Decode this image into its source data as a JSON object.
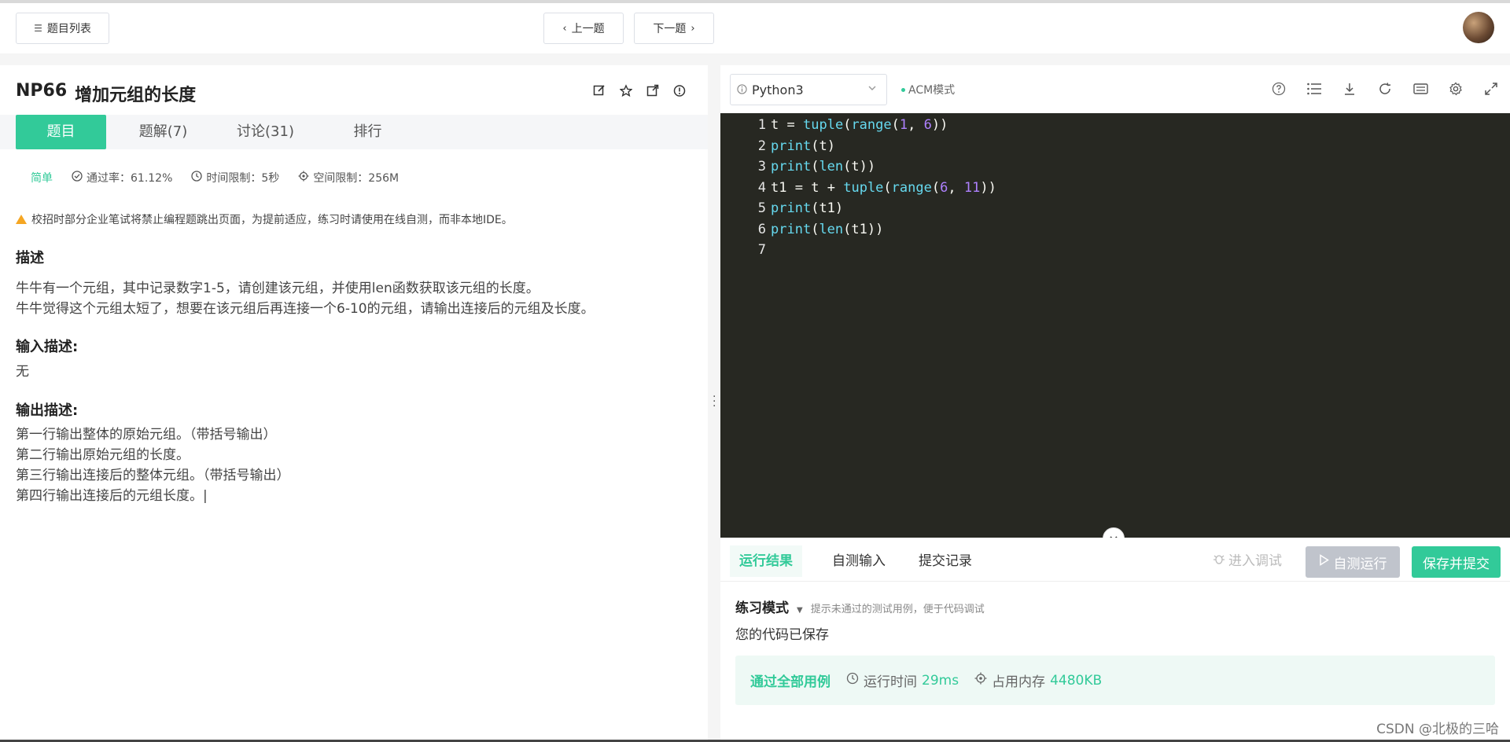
{
  "topbar": {
    "list_label": "题目列表",
    "prev_label": "上一题",
    "next_label": "下一题"
  },
  "problem": {
    "id": "NP66",
    "title": "增加元组的长度",
    "tabs": [
      "题目",
      "题解(7)",
      "讨论(31)",
      "排行"
    ],
    "difficulty": "简单",
    "pass_rate": "通过率：61.12%",
    "time_limit": "时间限制：5秒",
    "space_limit": "空间限制：256M",
    "notice": "校招时部分企业笔试将禁止编程题跳出页面，为提前适应，练习时请使用在线自测，而非本地IDE。",
    "desc_heading": "描述",
    "desc_lines": [
      "牛牛有一个元组，其中记录数字1-5，请创建该元组，并使用len函数获取该元组的长度。",
      "牛牛觉得这个元组太短了，想要在该元组后再连接一个6-10的元组，请输出连接后的元组及长度。"
    ],
    "input_heading": "输入描述:",
    "input_text": "无",
    "output_heading": "输出描述:",
    "output_lines": [
      "第一行输出整体的原始元组。（带括号输出）",
      "第二行输出原始元组的长度。",
      "第三行输出连接后的整体元组。（带括号输出）",
      "第四行输出连接后的元组长度。|"
    ]
  },
  "editor": {
    "language": "Python3",
    "mode": "ACM模式",
    "line_numbers": [
      "1",
      "2",
      "3",
      "4",
      "5",
      "6",
      "7"
    ],
    "code_lines": [
      "t = tuple(range(1, 6))",
      "print(t)",
      "print(len(t))",
      "t1 = t + tuple(range(6, 11))",
      "print(t1)",
      "print(len(t1))",
      ""
    ]
  },
  "results": {
    "tabs": [
      "运行结果",
      "自测输入",
      "提交记录"
    ],
    "debug_label": "进入调试",
    "run_label": "自测运行",
    "submit_label": "保存并提交",
    "practice_label": "练习模式",
    "practice_hint": "提示未通过的测试用例，便于代码调试",
    "saved_text": "您的代码已保存",
    "pass_text": "通过全部用例",
    "runtime_label": "运行时间",
    "runtime_value": "29ms",
    "memory_label": "占用内存",
    "memory_value": "4480KB"
  },
  "watermark": "CSDN @北极的三哈",
  "colors": {
    "accent": "#32ca99",
    "editor_bg": "#272822"
  }
}
